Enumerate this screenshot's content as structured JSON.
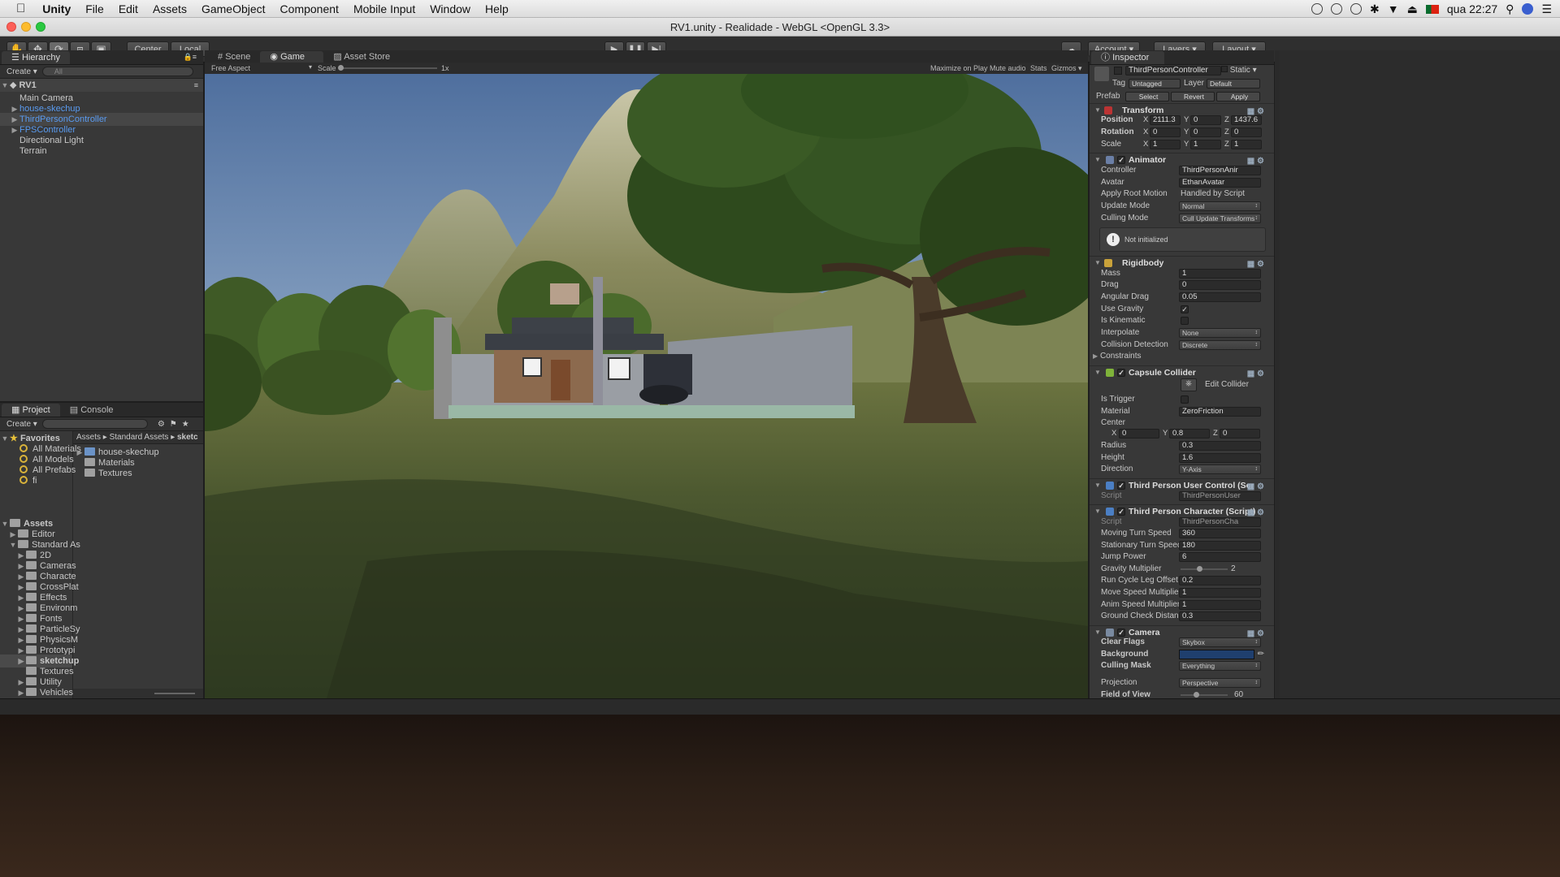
{
  "menubar": {
    "app": "Unity",
    "items": [
      "File",
      "Edit",
      "Assets",
      "GameObject",
      "Component",
      "Mobile Input",
      "Window",
      "Help"
    ],
    "clock": "qua 22:27"
  },
  "window": {
    "title": "RV1.unity - Realidade - WebGL <OpenGL 3.3>"
  },
  "toolbar": {
    "pivot": "Center",
    "space": "Local",
    "account": "Account",
    "layers": "Layers",
    "layout": "Layout"
  },
  "hierarchy": {
    "tab": "Hierarchy",
    "create": "Create",
    "search_placeholder": "All",
    "scene": "RV1",
    "items": [
      {
        "label": "Main Camera",
        "style": "normal",
        "expand": false
      },
      {
        "label": "house-skechup",
        "style": "blue",
        "expand": true
      },
      {
        "label": "ThirdPersonController",
        "style": "blue",
        "expand": true
      },
      {
        "label": "FPSController",
        "style": "blue",
        "expand": true
      },
      {
        "label": "Directional Light",
        "style": "normal",
        "expand": false
      },
      {
        "label": "Terrain",
        "style": "normal",
        "expand": false
      }
    ]
  },
  "project": {
    "tabs": [
      "Project",
      "Console"
    ],
    "create": "Create",
    "favorites": "Favorites",
    "fav_items": [
      "All Materials",
      "All Models",
      "All Prefabs",
      "fi"
    ],
    "assets_root": "Assets",
    "tree": [
      "Editor",
      "Standard As",
      "2D",
      "Cameras",
      "Characte",
      "CrossPlat",
      "Effects",
      "Environm",
      "Fonts",
      "ParticleSy",
      "PhysicsM",
      "Prototypi",
      "sketchup",
      "Textures",
      "Utility",
      "Vehicles"
    ],
    "breadcrumb": [
      "Assets",
      "Standard Assets",
      "sketc"
    ],
    "files": [
      "house-skechup",
      "Materials",
      "Textures"
    ]
  },
  "center_tabs": [
    "Scene",
    "Game",
    "Asset Store"
  ],
  "game_bar": {
    "aspect": "Free Aspect",
    "scale_label": "Scale",
    "scale_value": "1x",
    "maximize": "Maximize on Play",
    "mute": "Mute audio",
    "stats": "Stats",
    "gizmos": "Gizmos"
  },
  "inspector": {
    "tab": "Inspector",
    "object_name": "ThirdPersonController",
    "static": "Static",
    "tag_label": "Tag",
    "tag": "Untagged",
    "layer_label": "Layer",
    "layer": "Default",
    "prefab_label": "Prefab",
    "prefab_buttons": [
      "Select",
      "Revert",
      "Apply"
    ],
    "transform": {
      "title": "Transform",
      "position": {
        "label": "Position",
        "x": "2111.3",
        "y": "0",
        "z": "1437.6"
      },
      "rotation": {
        "label": "Rotation",
        "x": "0",
        "y": "0",
        "z": "0"
      },
      "scale": {
        "label": "Scale",
        "x": "1",
        "y": "1",
        "z": "1"
      }
    },
    "animator": {
      "title": "Animator",
      "controller_label": "Controller",
      "controller": "ThirdPersonAnir",
      "avatar_label": "Avatar",
      "avatar": "EthanAvatar",
      "root_motion_label": "Apply Root Motion",
      "root_motion": "Handled by Script",
      "update_label": "Update Mode",
      "update": "Normal",
      "culling_label": "Culling Mode",
      "culling": "Cull Update Transforms",
      "notice": "Not initialized"
    },
    "rigidbody": {
      "title": "Rigidbody",
      "mass_label": "Mass",
      "mass": "1",
      "drag_label": "Drag",
      "drag": "0",
      "angular_label": "Angular Drag",
      "angular": "0.05",
      "gravity_label": "Use Gravity",
      "gravity_checked": true,
      "kinematic_label": "Is Kinematic",
      "interpolate_label": "Interpolate",
      "interpolate": "None",
      "collision_label": "Collision Detection",
      "collision": "Discrete",
      "constraints": "Constraints"
    },
    "capsule": {
      "title": "Capsule Collider",
      "edit": "Edit Collider",
      "trigger_label": "Is Trigger",
      "material_label": "Material",
      "material": "ZeroFriction",
      "center_label": "Center",
      "cx": "0",
      "cy": "0.8",
      "cz": "0",
      "radius_label": "Radius",
      "radius": "0.3",
      "height_label": "Height",
      "height": "1.6",
      "direction_label": "Direction",
      "direction": "Y-Axis"
    },
    "user_control": {
      "title": "Third Person User Control (Scr",
      "script_label": "Script",
      "script": "ThirdPersonUser"
    },
    "character": {
      "title": "Third Person Character (Script)",
      "script_label": "Script",
      "script": "ThirdPersonCha",
      "moving_label": "Moving Turn Speed",
      "moving": "360",
      "stationary_label": "Stationary Turn Speed",
      "stationary": "180",
      "jump_label": "Jump Power",
      "jump": "6",
      "gravity_label": "Gravity Multiplier",
      "gravity": "2",
      "gravity_slider": 0.4,
      "runcycle_label": "Run Cycle Leg Offset",
      "runcycle": "0.2",
      "movespeed_label": "Move Speed Multiplier",
      "movespeed": "1",
      "animspeed_label": "Anim Speed Multiplier",
      "animspeed": "1",
      "ground_label": "Ground Check Distanc",
      "ground": "0.3"
    },
    "camera": {
      "title": "Camera",
      "clear_label": "Clear Flags",
      "clear": "Skybox",
      "bg_label": "Background",
      "bg_color": "#1f3f6e",
      "mask_label": "Culling Mask",
      "mask": "Everything",
      "projection_label": "Projection",
      "projection": "Perspective",
      "fov_label": "Field of View",
      "fov": "60",
      "fov_slider": 0.33
    }
  },
  "colors": {
    "accent_blue": "#5a9bf0",
    "panel": "#383838"
  }
}
